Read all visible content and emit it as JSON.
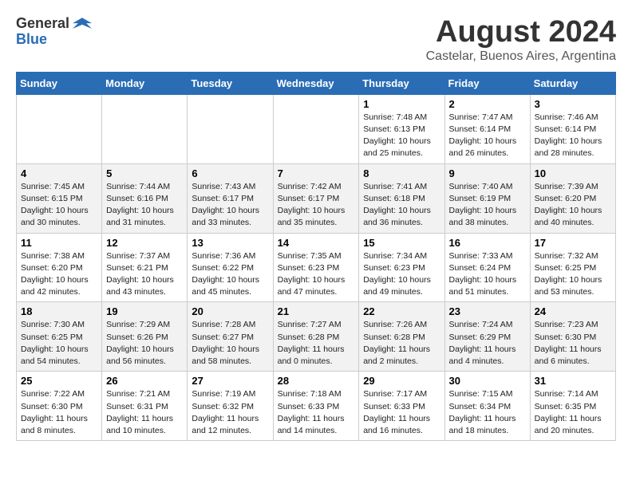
{
  "header": {
    "logo_general": "General",
    "logo_blue": "Blue",
    "month_year": "August 2024",
    "location": "Castelar, Buenos Aires, Argentina"
  },
  "days_of_week": [
    "Sunday",
    "Monday",
    "Tuesday",
    "Wednesday",
    "Thursday",
    "Friday",
    "Saturday"
  ],
  "weeks": [
    [
      {
        "day": "",
        "info": ""
      },
      {
        "day": "",
        "info": ""
      },
      {
        "day": "",
        "info": ""
      },
      {
        "day": "",
        "info": ""
      },
      {
        "day": "1",
        "info": "Sunrise: 7:48 AM\nSunset: 6:13 PM\nDaylight: 10 hours\nand 25 minutes."
      },
      {
        "day": "2",
        "info": "Sunrise: 7:47 AM\nSunset: 6:14 PM\nDaylight: 10 hours\nand 26 minutes."
      },
      {
        "day": "3",
        "info": "Sunrise: 7:46 AM\nSunset: 6:14 PM\nDaylight: 10 hours\nand 28 minutes."
      }
    ],
    [
      {
        "day": "4",
        "info": "Sunrise: 7:45 AM\nSunset: 6:15 PM\nDaylight: 10 hours\nand 30 minutes."
      },
      {
        "day": "5",
        "info": "Sunrise: 7:44 AM\nSunset: 6:16 PM\nDaylight: 10 hours\nand 31 minutes."
      },
      {
        "day": "6",
        "info": "Sunrise: 7:43 AM\nSunset: 6:17 PM\nDaylight: 10 hours\nand 33 minutes."
      },
      {
        "day": "7",
        "info": "Sunrise: 7:42 AM\nSunset: 6:17 PM\nDaylight: 10 hours\nand 35 minutes."
      },
      {
        "day": "8",
        "info": "Sunrise: 7:41 AM\nSunset: 6:18 PM\nDaylight: 10 hours\nand 36 minutes."
      },
      {
        "day": "9",
        "info": "Sunrise: 7:40 AM\nSunset: 6:19 PM\nDaylight: 10 hours\nand 38 minutes."
      },
      {
        "day": "10",
        "info": "Sunrise: 7:39 AM\nSunset: 6:20 PM\nDaylight: 10 hours\nand 40 minutes."
      }
    ],
    [
      {
        "day": "11",
        "info": "Sunrise: 7:38 AM\nSunset: 6:20 PM\nDaylight: 10 hours\nand 42 minutes."
      },
      {
        "day": "12",
        "info": "Sunrise: 7:37 AM\nSunset: 6:21 PM\nDaylight: 10 hours\nand 43 minutes."
      },
      {
        "day": "13",
        "info": "Sunrise: 7:36 AM\nSunset: 6:22 PM\nDaylight: 10 hours\nand 45 minutes."
      },
      {
        "day": "14",
        "info": "Sunrise: 7:35 AM\nSunset: 6:23 PM\nDaylight: 10 hours\nand 47 minutes."
      },
      {
        "day": "15",
        "info": "Sunrise: 7:34 AM\nSunset: 6:23 PM\nDaylight: 10 hours\nand 49 minutes."
      },
      {
        "day": "16",
        "info": "Sunrise: 7:33 AM\nSunset: 6:24 PM\nDaylight: 10 hours\nand 51 minutes."
      },
      {
        "day": "17",
        "info": "Sunrise: 7:32 AM\nSunset: 6:25 PM\nDaylight: 10 hours\nand 53 minutes."
      }
    ],
    [
      {
        "day": "18",
        "info": "Sunrise: 7:30 AM\nSunset: 6:25 PM\nDaylight: 10 hours\nand 54 minutes."
      },
      {
        "day": "19",
        "info": "Sunrise: 7:29 AM\nSunset: 6:26 PM\nDaylight: 10 hours\nand 56 minutes."
      },
      {
        "day": "20",
        "info": "Sunrise: 7:28 AM\nSunset: 6:27 PM\nDaylight: 10 hours\nand 58 minutes."
      },
      {
        "day": "21",
        "info": "Sunrise: 7:27 AM\nSunset: 6:28 PM\nDaylight: 11 hours\nand 0 minutes."
      },
      {
        "day": "22",
        "info": "Sunrise: 7:26 AM\nSunset: 6:28 PM\nDaylight: 11 hours\nand 2 minutes."
      },
      {
        "day": "23",
        "info": "Sunrise: 7:24 AM\nSunset: 6:29 PM\nDaylight: 11 hours\nand 4 minutes."
      },
      {
        "day": "24",
        "info": "Sunrise: 7:23 AM\nSunset: 6:30 PM\nDaylight: 11 hours\nand 6 minutes."
      }
    ],
    [
      {
        "day": "25",
        "info": "Sunrise: 7:22 AM\nSunset: 6:30 PM\nDaylight: 11 hours\nand 8 minutes."
      },
      {
        "day": "26",
        "info": "Sunrise: 7:21 AM\nSunset: 6:31 PM\nDaylight: 11 hours\nand 10 minutes."
      },
      {
        "day": "27",
        "info": "Sunrise: 7:19 AM\nSunset: 6:32 PM\nDaylight: 11 hours\nand 12 minutes."
      },
      {
        "day": "28",
        "info": "Sunrise: 7:18 AM\nSunset: 6:33 PM\nDaylight: 11 hours\nand 14 minutes."
      },
      {
        "day": "29",
        "info": "Sunrise: 7:17 AM\nSunset: 6:33 PM\nDaylight: 11 hours\nand 16 minutes."
      },
      {
        "day": "30",
        "info": "Sunrise: 7:15 AM\nSunset: 6:34 PM\nDaylight: 11 hours\nand 18 minutes."
      },
      {
        "day": "31",
        "info": "Sunrise: 7:14 AM\nSunset: 6:35 PM\nDaylight: 11 hours\nand 20 minutes."
      }
    ]
  ]
}
